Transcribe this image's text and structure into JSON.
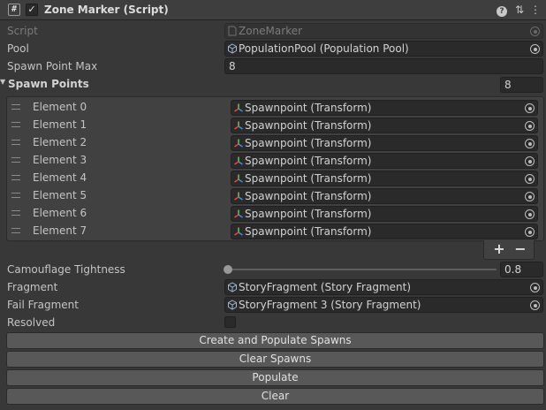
{
  "header": {
    "script_icon": "#",
    "enabled_check": "✓",
    "title": "Zone Marker (Script)",
    "help_icon": "?",
    "preset_icon": "⇅",
    "menu_icon": "⋮"
  },
  "fields": {
    "script": {
      "label": "Script",
      "value": "ZoneMarker",
      "icon": "script-file-icon"
    },
    "pool": {
      "label": "Pool",
      "value": "PopulationPool (Population Pool)",
      "icon": "scriptable-object-icon"
    },
    "spawn_point_max": {
      "label": "Spawn Point Max",
      "value": "8"
    },
    "spawn_points": {
      "label": "Spawn Points",
      "size": "8",
      "elements": [
        {
          "label": "Element 0",
          "value": "Spawnpoint (Transform)"
        },
        {
          "label": "Element 1",
          "value": "Spawnpoint (Transform)"
        },
        {
          "label": "Element 2",
          "value": "Spawnpoint (Transform)"
        },
        {
          "label": "Element 3",
          "value": "Spawnpoint (Transform)"
        },
        {
          "label": "Element 4",
          "value": "Spawnpoint (Transform)"
        },
        {
          "label": "Element 5",
          "value": "Spawnpoint (Transform)"
        },
        {
          "label": "Element 6",
          "value": "Spawnpoint (Transform)"
        },
        {
          "label": "Element 7",
          "value": "Spawnpoint (Transform)"
        }
      ],
      "add_label": "+",
      "remove_label": "−"
    },
    "camouflage_tightness": {
      "label": "Camouflage Tightness",
      "value": "0.8",
      "slider_fraction": 0.0
    },
    "fragment": {
      "label": "Fragment",
      "value": "StoryFragment (Story Fragment)",
      "icon": "scriptable-object-icon"
    },
    "fail_fragment": {
      "label": "Fail Fragment",
      "value": "StoryFragment 3 (Story Fragment)",
      "icon": "scriptable-object-icon"
    },
    "resolved": {
      "label": "Resolved",
      "checked": false
    }
  },
  "buttons": {
    "create_and_populate": "Create and Populate Spawns",
    "clear_spawns": "Clear Spawns",
    "populate": "Populate",
    "clear": "Clear"
  },
  "colors": {
    "background": "#383838",
    "field_bg": "#2a2a2a",
    "button_bg": "#585858",
    "transform_axis_x": "#e0503a",
    "transform_axis_y": "#7fc94a",
    "transform_axis_z": "#4a8ee0"
  }
}
